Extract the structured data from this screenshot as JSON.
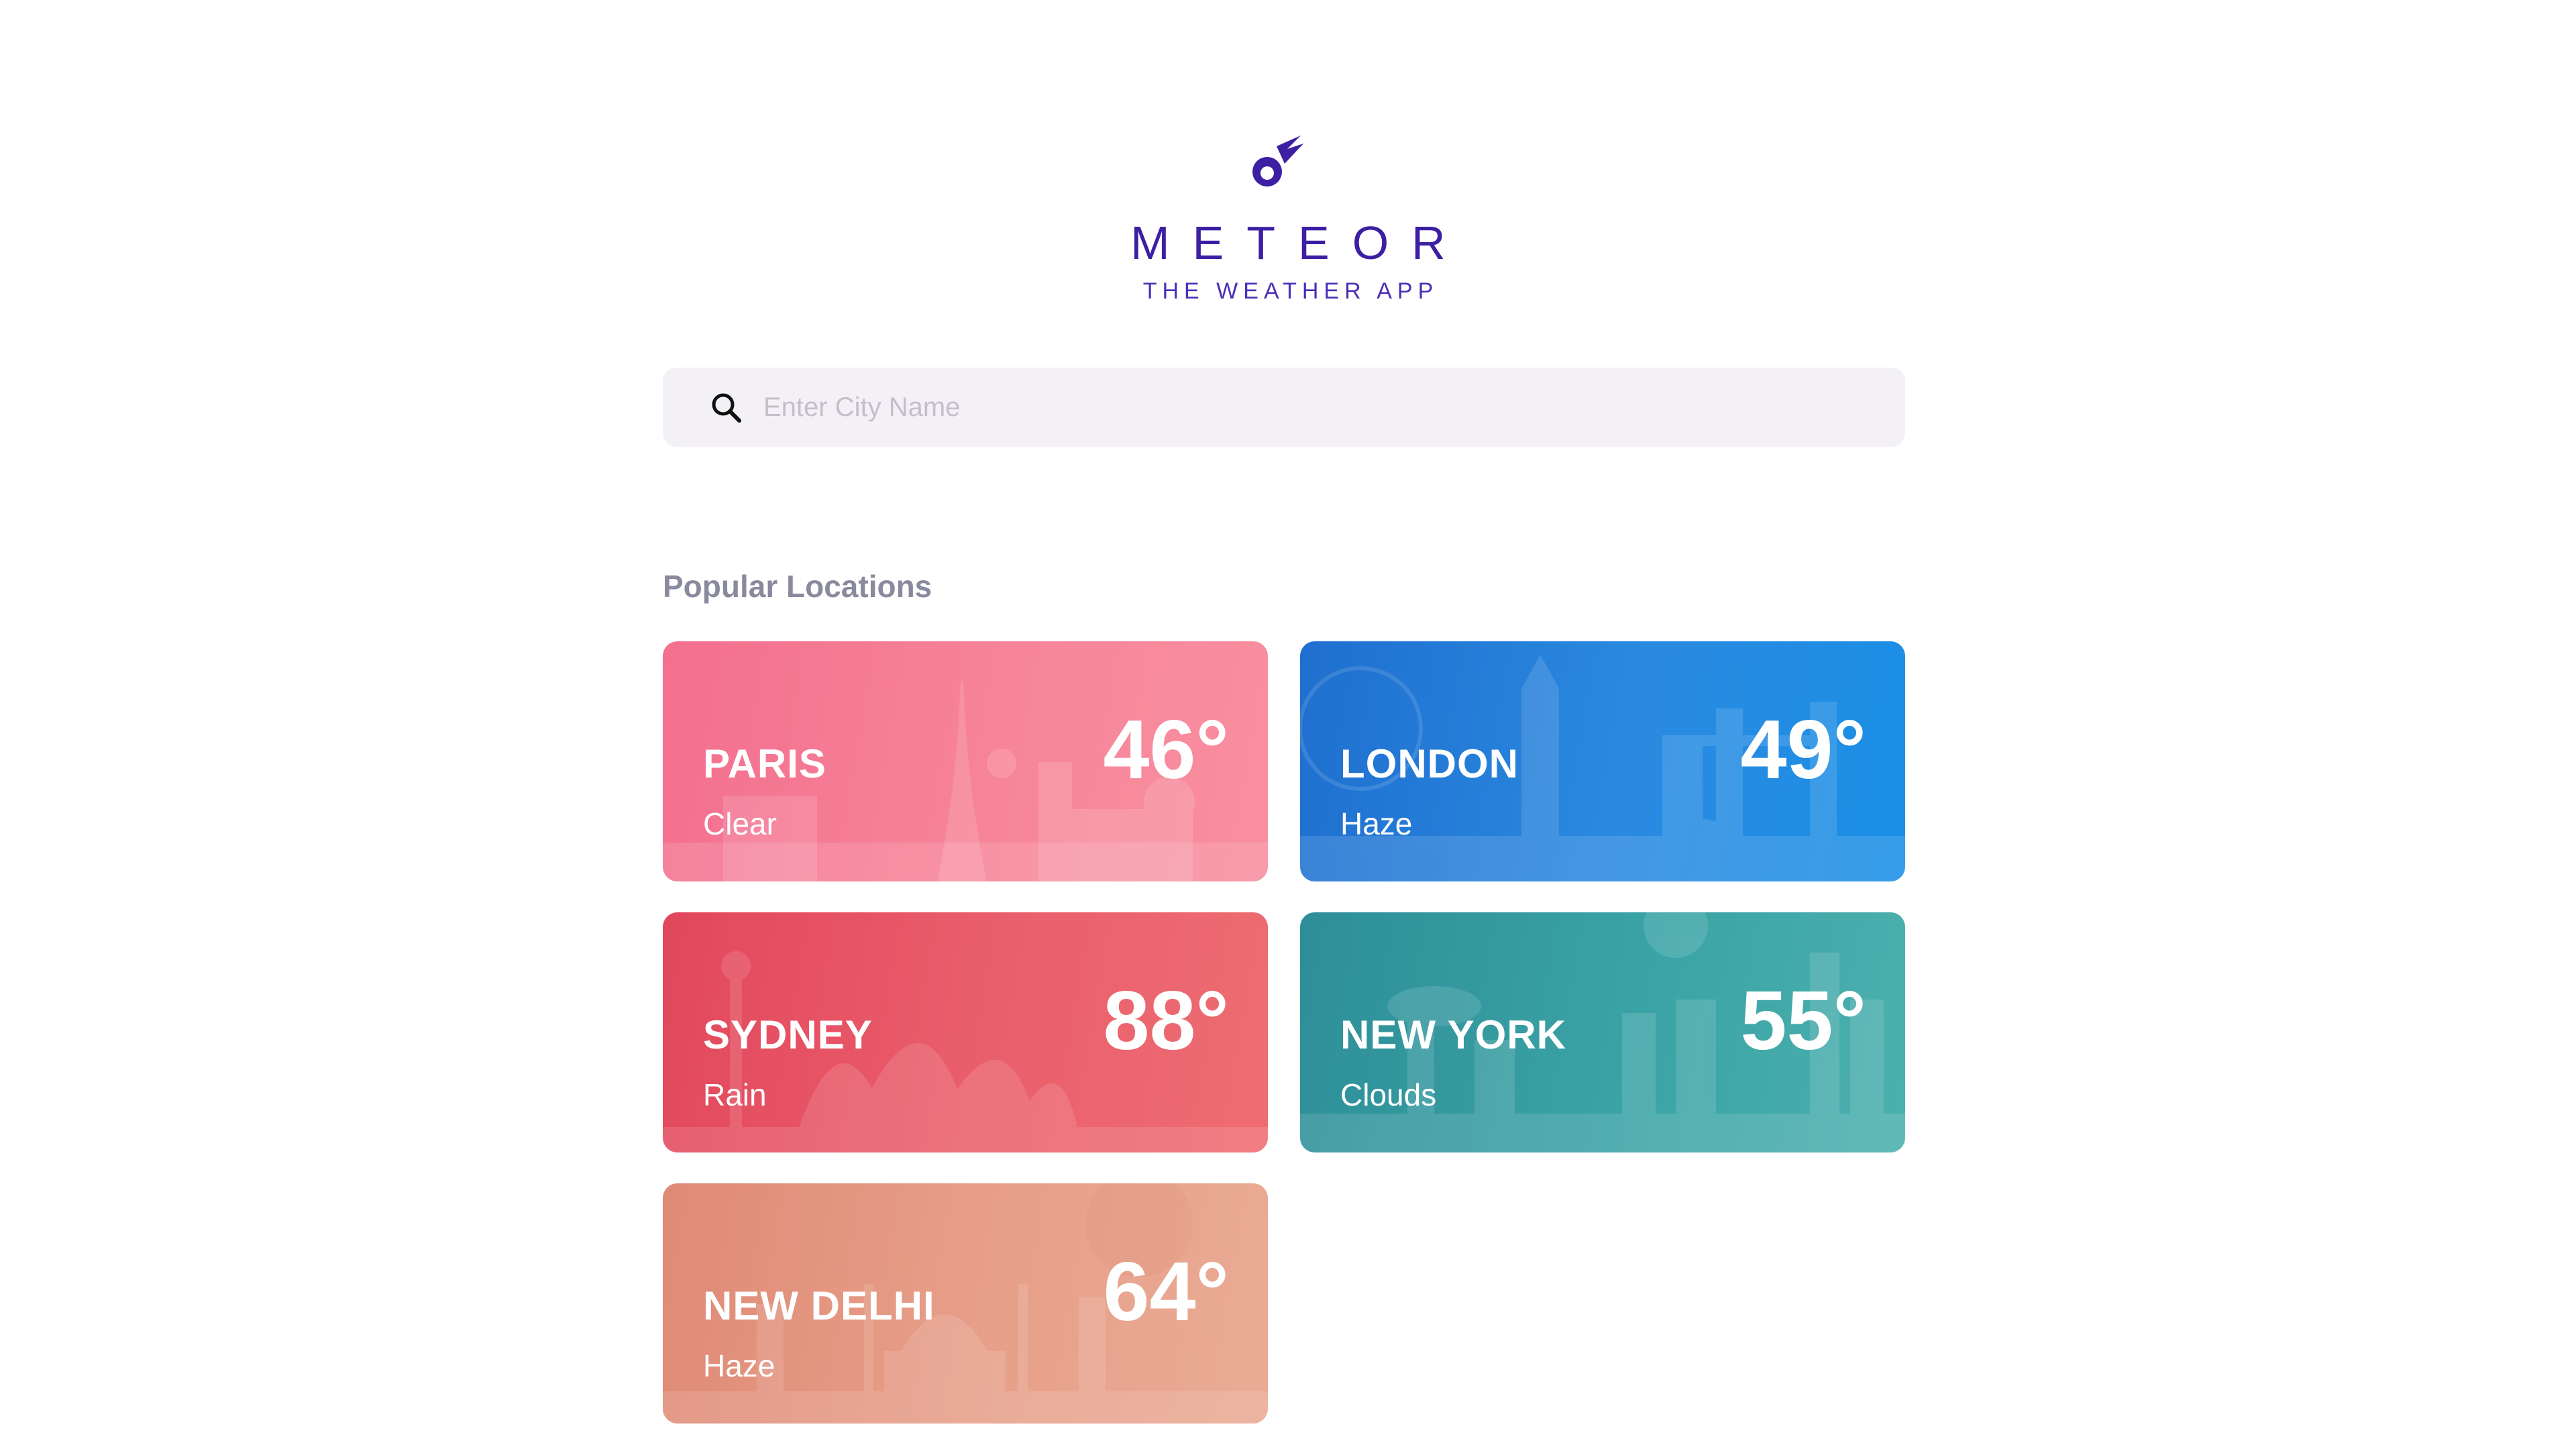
{
  "brand": {
    "name": "METEOR",
    "tagline": "THE WEATHER APP",
    "color": "#3d1fa3",
    "logo_icon": "meteor-icon"
  },
  "search": {
    "placeholder": "Enter City Name",
    "value": "",
    "icon": "search-icon"
  },
  "popular": {
    "title": "Popular Locations",
    "cards": [
      {
        "city": "PARIS",
        "condition": "Clear",
        "temp": "46°",
        "color": "#f36f8e"
      },
      {
        "city": "LONDON",
        "condition": "Haze",
        "temp": "49°",
        "color": "#1f6fcf"
      },
      {
        "city": "SYDNEY",
        "condition": "Rain",
        "temp": "88°",
        "color": "#e2475c"
      },
      {
        "city": "NEW YORK",
        "condition": "Clouds",
        "temp": "55°",
        "color": "#2e8e98"
      },
      {
        "city": "NEW DELHI",
        "condition": "Haze",
        "temp": "64°",
        "color": "#df8a76"
      }
    ]
  }
}
